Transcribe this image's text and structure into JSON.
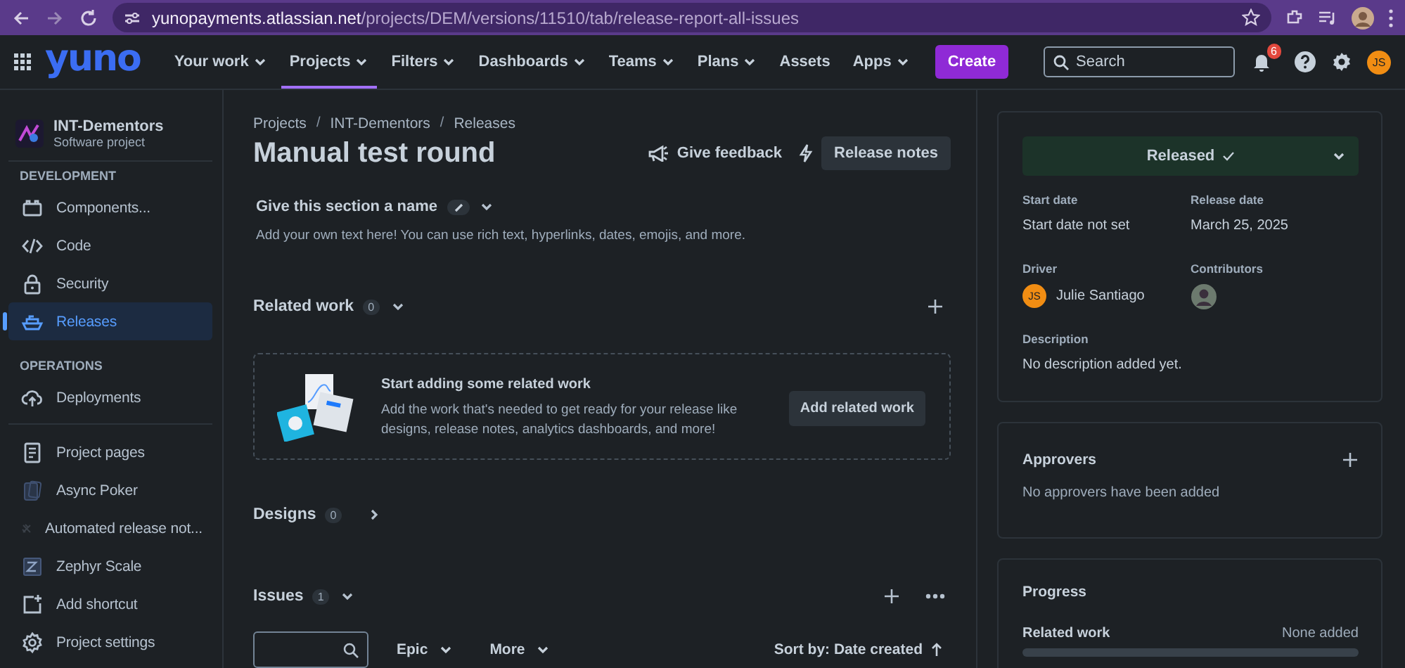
{
  "browser": {
    "url_host": "yunopayments.atlassian.net",
    "url_path": "/projects/DEM/versions/11510/tab/release-report-all-issues"
  },
  "topnav": {
    "logo": "yuno",
    "menus": [
      {
        "label": "Your work",
        "dropdown": true,
        "selected": false
      },
      {
        "label": "Projects",
        "dropdown": true,
        "selected": true
      },
      {
        "label": "Filters",
        "dropdown": true,
        "selected": false
      },
      {
        "label": "Dashboards",
        "dropdown": true,
        "selected": false
      },
      {
        "label": "Teams",
        "dropdown": true,
        "selected": false
      },
      {
        "label": "Plans",
        "dropdown": true,
        "selected": false
      },
      {
        "label": "Assets",
        "dropdown": false,
        "selected": false
      },
      {
        "label": "Apps",
        "dropdown": true,
        "selected": false
      }
    ],
    "create": "Create",
    "search": {
      "placeholder": "Search"
    },
    "notification_count": "6",
    "avatar_initials": "JS"
  },
  "sidebar": {
    "project": {
      "name": "INT-Dementors",
      "type": "Software project"
    },
    "sections": [
      {
        "heading": "DEVELOPMENT",
        "items": [
          {
            "label": "Components...",
            "selected": false
          },
          {
            "label": "Code",
            "selected": false
          },
          {
            "label": "Security",
            "selected": false
          },
          {
            "label": "Releases",
            "selected": true
          }
        ]
      },
      {
        "heading": "OPERATIONS",
        "items": [
          {
            "label": "Deployments",
            "selected": false
          }
        ]
      },
      {
        "items": [
          {
            "label": "Project pages",
            "selected": false
          },
          {
            "label": "Async Poker",
            "selected": false
          },
          {
            "label": "Automated release not...",
            "selected": false
          },
          {
            "label": "Zephyr Scale",
            "selected": false
          },
          {
            "label": "Add shortcut",
            "selected": false
          },
          {
            "label": "Project settings",
            "selected": false
          }
        ]
      }
    ]
  },
  "main": {
    "breadcrumbs": [
      {
        "kind": "link",
        "text": "Projects"
      },
      {
        "kind": "separator",
        "text": "/"
      },
      {
        "kind": "link",
        "text": "INT-Dementors"
      },
      {
        "kind": "separator",
        "text": "/"
      },
      {
        "kind": "link",
        "text": "Releases"
      }
    ],
    "title": "Manual test round",
    "actions": {
      "feedback": "Give feedback",
      "release_notes": "Release notes"
    },
    "custom_section": {
      "title": "Give this section a name",
      "text": "Add your own text here! You can use rich text, hyperlinks, dates, emojis, and more."
    },
    "sections": [
      {
        "kind": "related",
        "title": "Related work",
        "count": "0",
        "expanded": true,
        "add": true,
        "empty_state": {
          "title": "Start adding some related work",
          "text": "Add the work that's needed to get ready for your release like designs, release notes, analytics dashboards, and more!",
          "button": "Add related work"
        }
      },
      {
        "kind": "designs",
        "title": "Designs",
        "count": "0",
        "expanded": false,
        "add": false
      },
      {
        "kind": "issues",
        "title": "Issues",
        "count": "1",
        "expanded": true,
        "add": true,
        "filters": [
          "Epic",
          "More"
        ],
        "sort": "Sort by: Date created"
      }
    ]
  },
  "panel": {
    "status": "Released",
    "fields": [
      {
        "label": "Start date",
        "value": "Start date not set"
      },
      {
        "label": "Release date",
        "value": "March 25, 2025"
      }
    ],
    "driver": {
      "label": "Driver",
      "name": "Julie Santiago",
      "initials": "JS"
    },
    "contributors": {
      "label": "Contributors"
    },
    "description": {
      "label": "Description",
      "value": "No description added yet."
    },
    "approvers": {
      "title": "Approvers",
      "text": "No approvers have been added"
    },
    "progress": {
      "title": "Progress",
      "rows": [
        {
          "label": "Related work",
          "value": "None added",
          "level": 0
        }
      ]
    }
  }
}
